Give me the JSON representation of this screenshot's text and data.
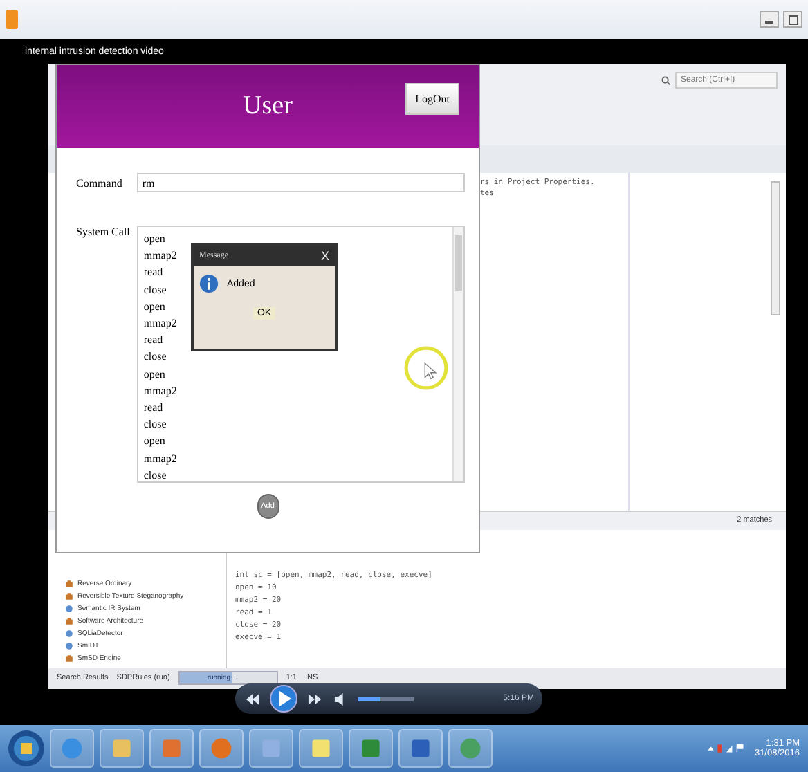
{
  "video": {
    "title": "internal intrusion detection video"
  },
  "ide": {
    "search": {
      "placeholder": "Search (Ctrl+I)"
    },
    "output_lines": [
      "rs in Project Properties.",
      "tes"
    ],
    "matches": "2 matches",
    "tree": [
      {
        "label": "Reverse Ordinary",
        "kind": "folder"
      },
      {
        "label": "Reversible Texture Steganography",
        "kind": "folder"
      },
      {
        "label": "Semantic IR System",
        "kind": "globe"
      },
      {
        "label": "Software Architecture",
        "kind": "folder"
      },
      {
        "label": "SQLiaDetector",
        "kind": "globe"
      },
      {
        "label": "SmIDT",
        "kind": "globe"
      },
      {
        "label": "SmSD Engine",
        "kind": "folder"
      }
    ],
    "code_lines": [
      "int sc = [open, mmap2, read, close, execve]",
      "open = 10",
      "mmap2 = 20",
      "read = 1",
      "close = 20",
      "execve = 1"
    ],
    "search_results": "Search Results",
    "status": {
      "task": "SDPRules (run)",
      "progress_text": "running...",
      "level": 0.55,
      "position": "1:1",
      "mode": "INS"
    }
  },
  "user_window": {
    "title": "User",
    "logout": "LogOut",
    "command_label": "Command",
    "command_value": "rm",
    "system_call_label": "System Call",
    "system_calls": [
      "open",
      "mmap2",
      "read",
      "close",
      "open",
      "mmap2",
      "read",
      "close",
      "open",
      "mmap2",
      "read",
      "close",
      "open",
      "mmap2",
      "close"
    ],
    "add": "Add"
  },
  "dialog": {
    "title": "Message",
    "close": "X",
    "message": "Added",
    "ok": "OK"
  },
  "player": {
    "time": "5:16 PM",
    "volume": {
      "level": 0.4
    }
  },
  "taskbar": {
    "time": "1:31 PM",
    "date": "31/08/2016"
  }
}
